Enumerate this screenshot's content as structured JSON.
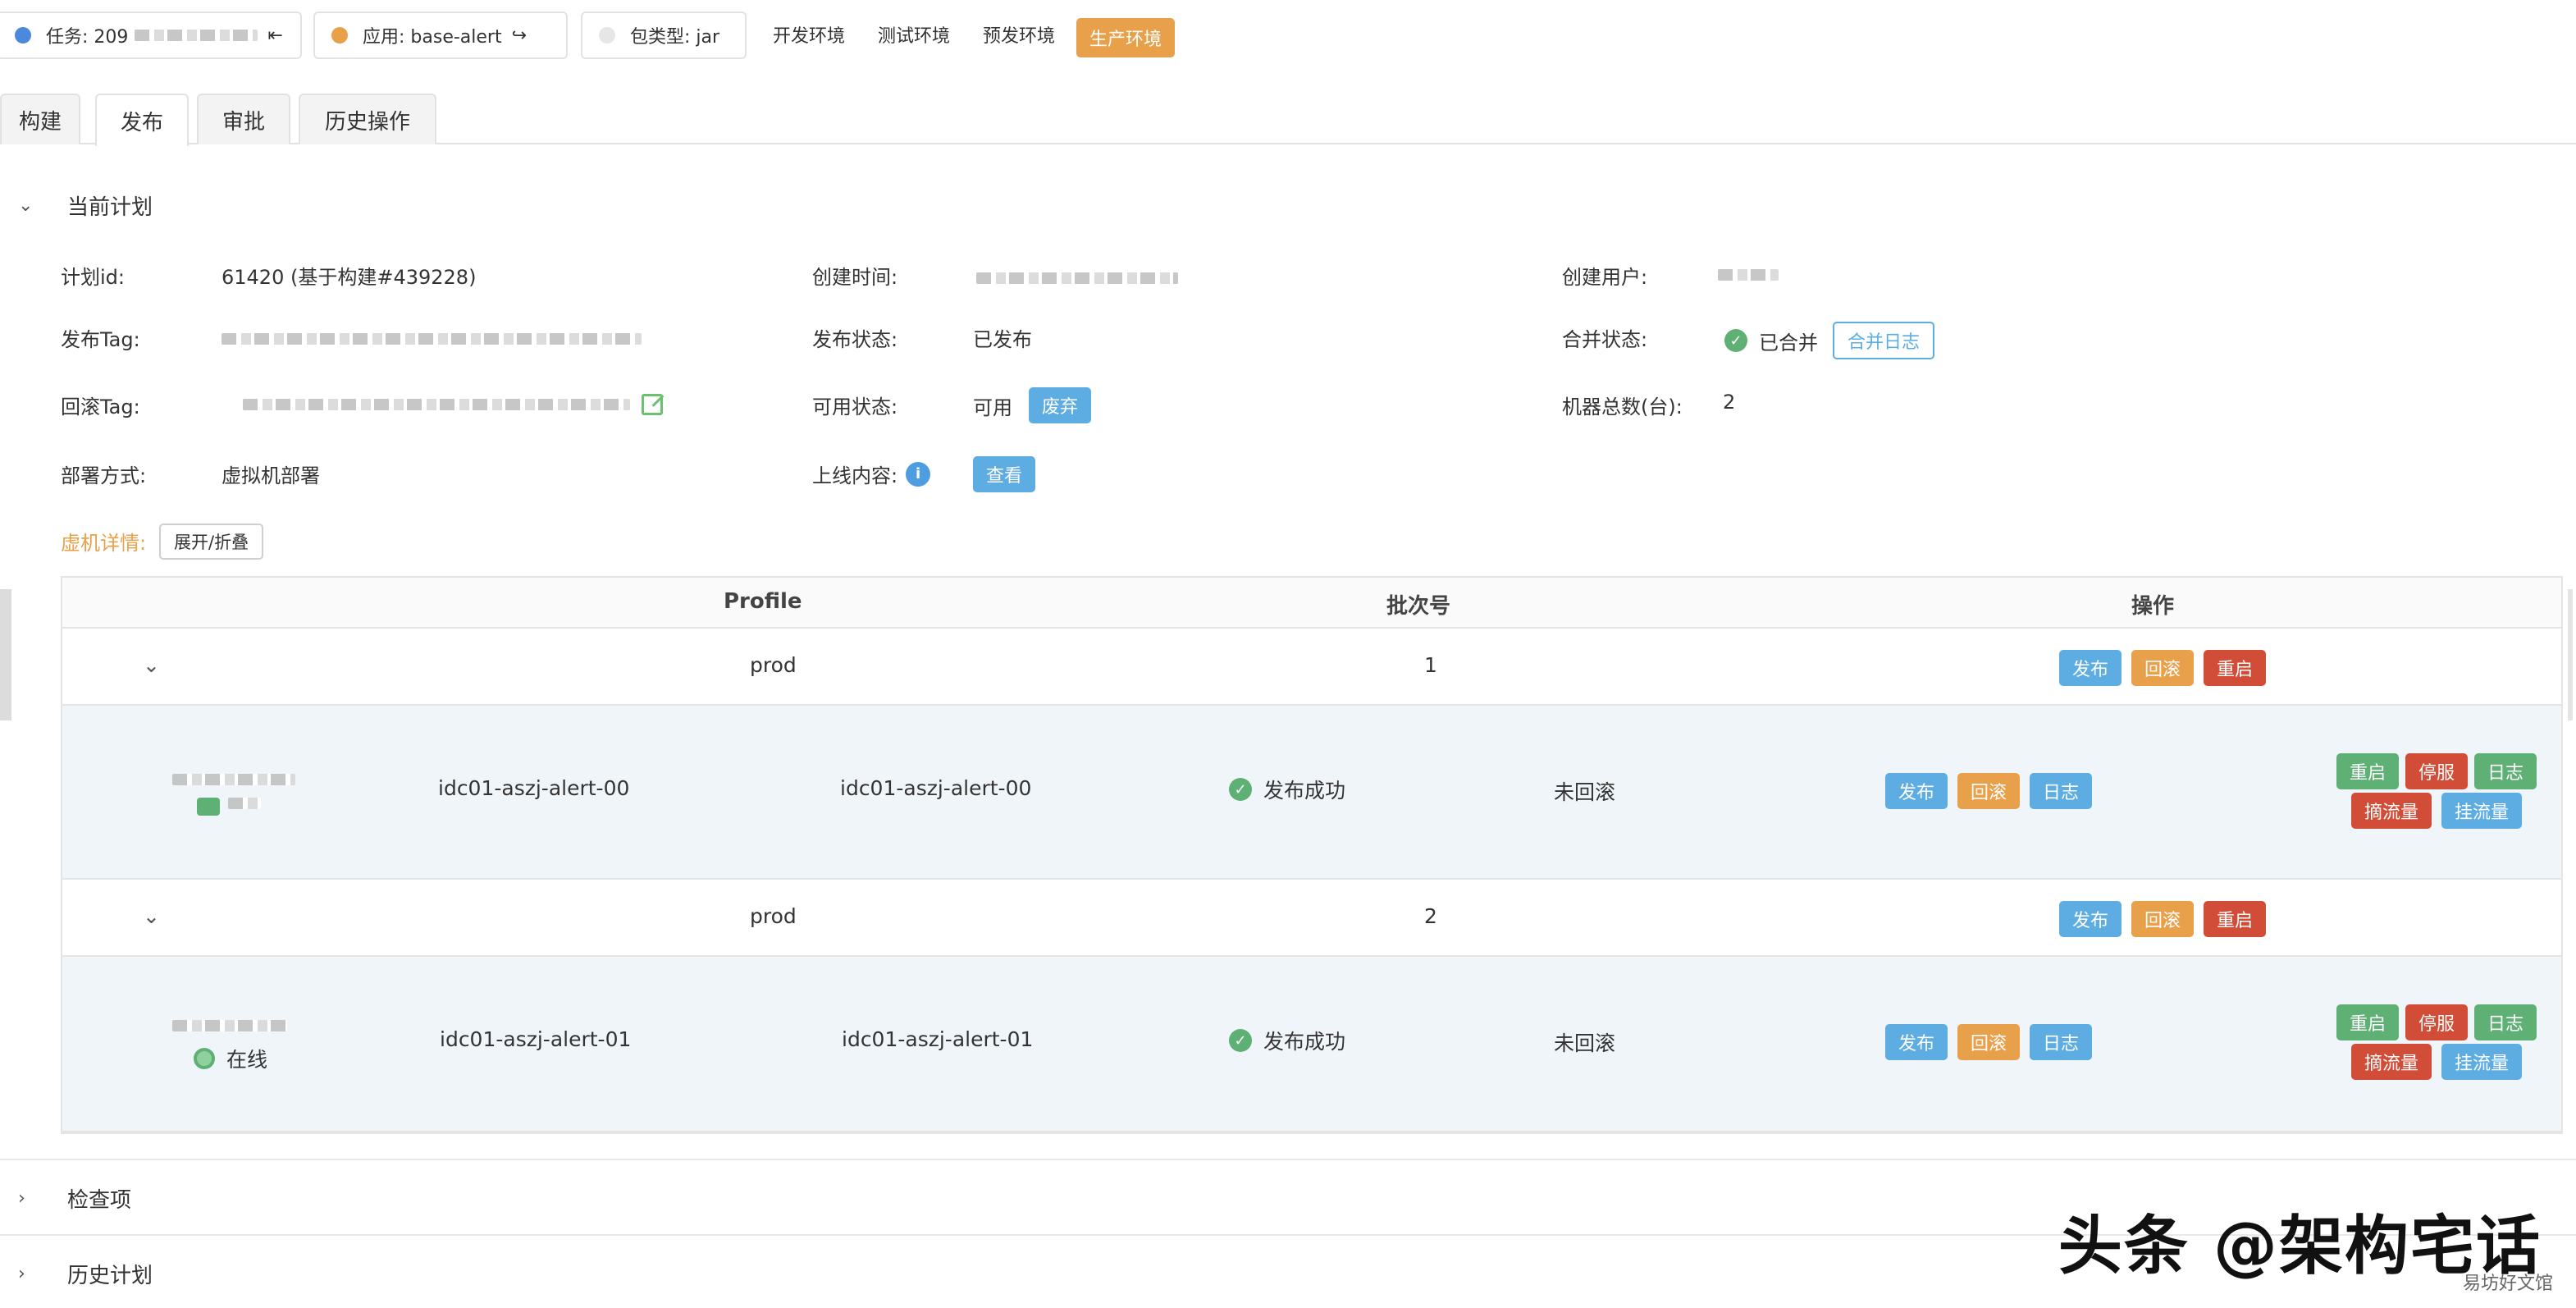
{
  "topbar": {
    "task_label": "任务: 209",
    "app_label": "应用: base-alert",
    "pkg_label": "包类型: jar",
    "envs": [
      "开发环境",
      "测试环境",
      "预发环境",
      "生产环境"
    ],
    "active_env": "生产环境",
    "colors": {
      "task_dot": "#4a89dc",
      "app_dot": "#e8a14a",
      "pkg_dot": "#e6e6e6",
      "active_env_bg": "#e8a14a"
    }
  },
  "tabs": [
    "构建",
    "发布",
    "审批",
    "历史操作"
  ],
  "active_tab": "发布",
  "current_plan": {
    "title": "当前计划",
    "plan_id_label": "计划id:",
    "plan_id_value": "61420 (基于构建#439228)",
    "create_time_label": "创建时间:",
    "create_user_label": "创建用户:",
    "publish_tag_label": "发布Tag:",
    "publish_status_label": "发布状态:",
    "publish_status_value": "已发布",
    "merge_status_label": "合并状态:",
    "merge_status_value": "已合并",
    "merge_log_button": "合并日志",
    "rollback_tag_label": "回滚Tag:",
    "available_status_label": "可用状态:",
    "available_status_value": "可用",
    "discard_button": "废弃",
    "machine_total_label": "机器总数(台):",
    "machine_total_value": "2",
    "deploy_mode_label": "部署方式:",
    "deploy_mode_value": "虚拟机部署",
    "online_content_label": "上线内容:",
    "view_button": "查看",
    "vm_detail_label": "虚机详情:",
    "expand_button": "展开/折叠"
  },
  "table": {
    "headers": [
      "Profile",
      "批次号",
      "操作"
    ],
    "groups": [
      {
        "profile": "prod",
        "batch": "1",
        "actions": [
          "发布",
          "回滚",
          "重启"
        ],
        "host": {
          "status_text": "",
          "hostname": "idc01-aszj-alert-00",
          "instance": "idc01-aszj-alert-00",
          "publish_status": "发布成功",
          "rollback_status": "未回滚",
          "actions": [
            "发布",
            "回滚",
            "日志"
          ],
          "ops_row1": [
            "重启",
            "停服",
            "日志"
          ],
          "ops_row2": [
            "摘流量",
            "挂流量"
          ]
        }
      },
      {
        "profile": "prod",
        "batch": "2",
        "actions": [
          "发布",
          "回滚",
          "重启"
        ],
        "host": {
          "status_text": "在线",
          "hostname": "idc01-aszj-alert-01",
          "instance": "idc01-aszj-alert-01",
          "publish_status": "发布成功",
          "rollback_status": "未回滚",
          "actions": [
            "发布",
            "回滚",
            "日志"
          ],
          "ops_row1": [
            "重启",
            "停服",
            "日志"
          ],
          "ops_row2": [
            "摘流量",
            "挂流量"
          ]
        }
      }
    ]
  },
  "sections": {
    "check_items": "检查项",
    "history_plans": "历史计划"
  },
  "watermark": {
    "main": "头条 @架构宅话",
    "sub": "易坊好文馆"
  }
}
